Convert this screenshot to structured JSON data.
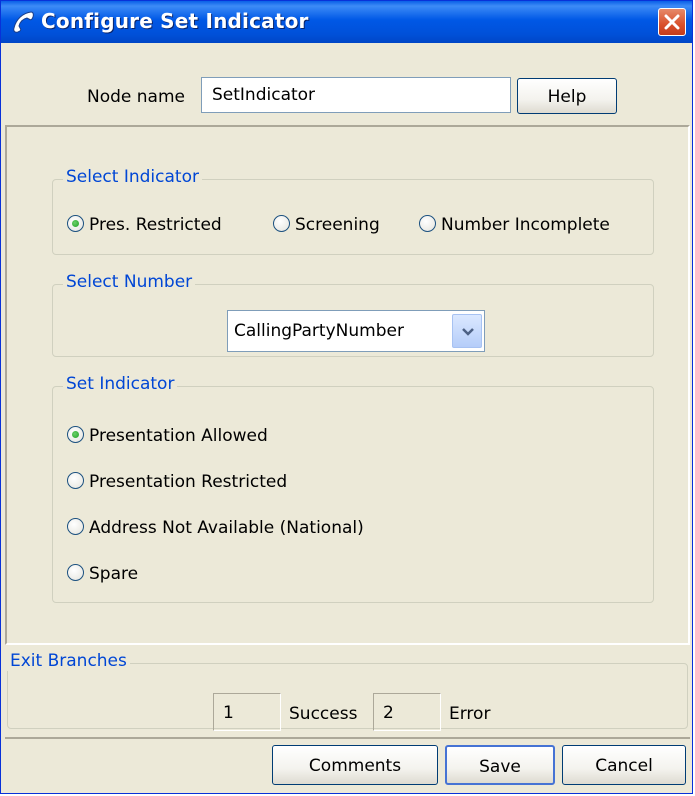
{
  "window": {
    "title": "Configure Set Indicator",
    "title_icon": "phone-handset-icon",
    "close_icon": "close-icon"
  },
  "node": {
    "label": "Node name",
    "value": "SetIndicator",
    "help_label": "Help"
  },
  "select_indicator": {
    "legend": "Select Indicator",
    "options": [
      "Pres. Restricted",
      "Screening",
      "Number Incomplete"
    ],
    "selected": "Pres. Restricted"
  },
  "select_number": {
    "legend": "Select Number",
    "value": "CallingPartyNumber"
  },
  "set_indicator": {
    "legend": "Set Indicator",
    "options": [
      "Presentation Allowed",
      "Presentation Restricted",
      "Address Not Available (National)",
      "Spare"
    ],
    "selected": "Presentation Allowed"
  },
  "exit_branches": {
    "legend": "Exit Branches",
    "branches": [
      {
        "number": "1",
        "label": "Success"
      },
      {
        "number": "2",
        "label": "Error"
      }
    ]
  },
  "footer": {
    "comments_label": "Comments",
    "save_label": "Save",
    "cancel_label": "Cancel"
  },
  "colors": {
    "title_bar": "#0058e6",
    "window_bg": "#ece9d8",
    "legend_text": "#0046d5",
    "radio_selected": "#21a121"
  }
}
